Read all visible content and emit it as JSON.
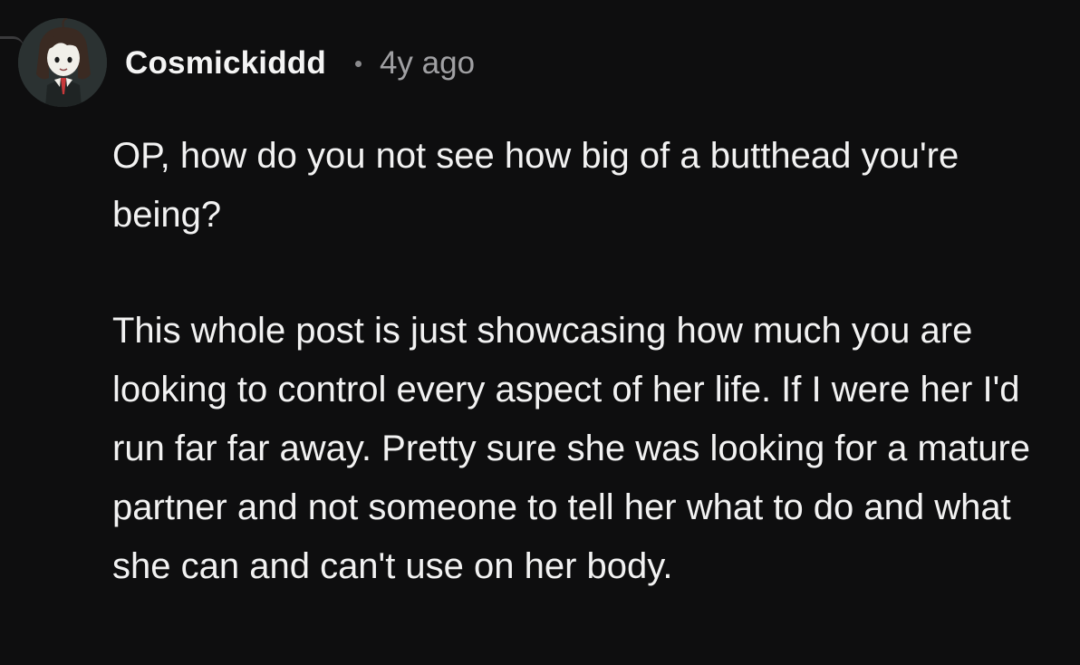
{
  "comment": {
    "username": "Cosmickiddd",
    "timestamp": "4y ago",
    "avatar": {
      "description_icon": "user-avatar-icon",
      "background_color": "#2b3232"
    },
    "paragraphs": [
      "OP, how do you not see how big of a butthead you're being?",
      "This whole post is just showcasing how much you are looking to control every aspect of her life. If I were her I'd run far far away. Pretty sure she was looking for a mature partner and not someone to tell her what to do and what she can and can't use on her body."
    ]
  },
  "colors": {
    "background": "#0e0e0f",
    "text": "#f2f2f2",
    "muted": "#a0a0a3"
  }
}
